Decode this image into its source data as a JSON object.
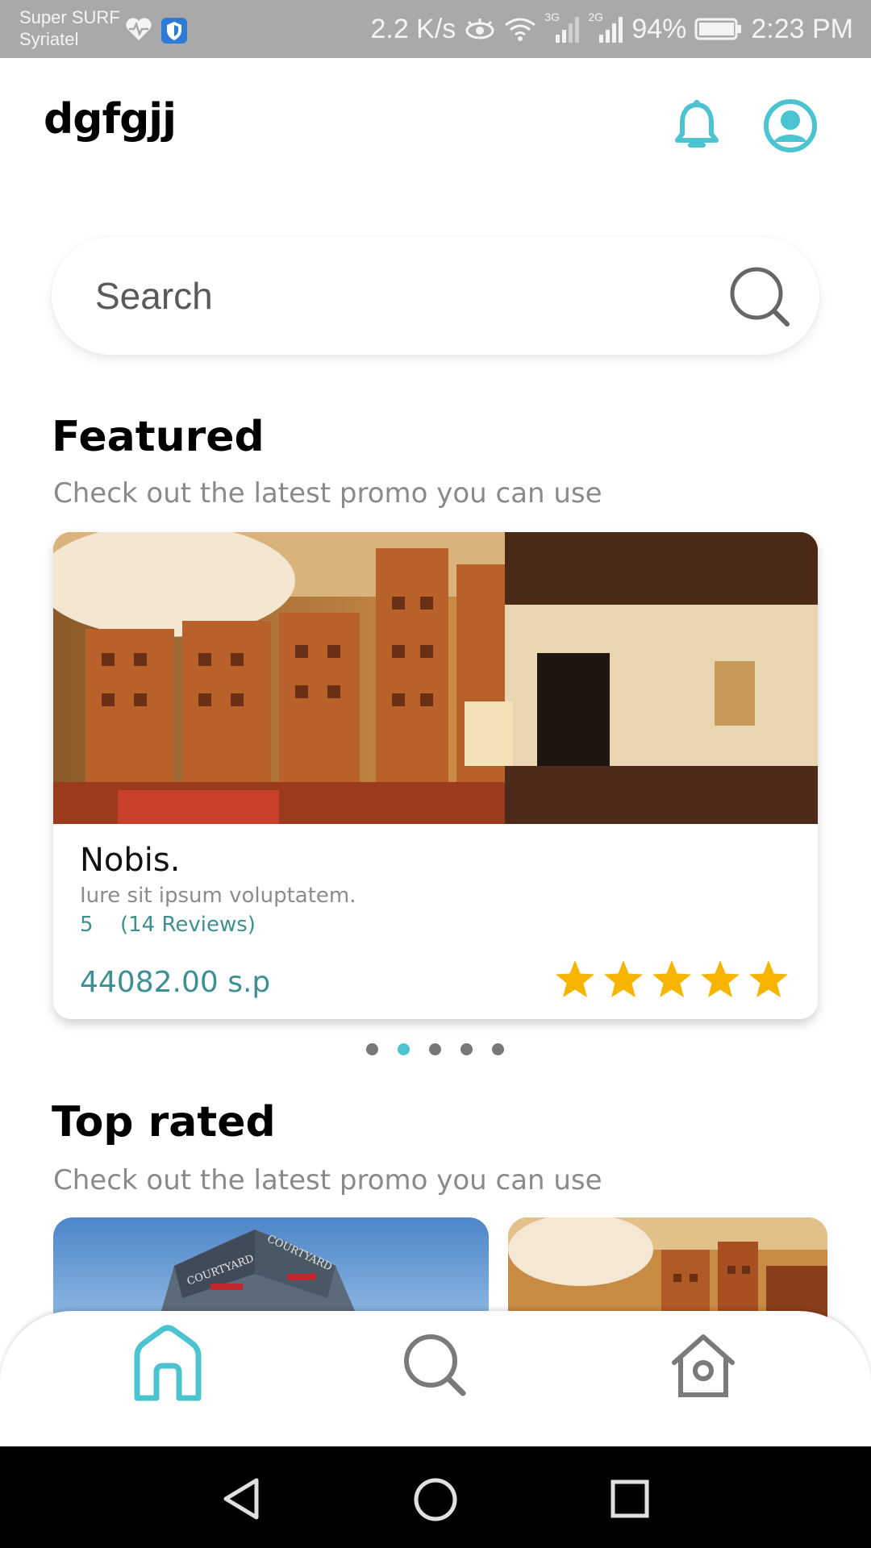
{
  "status_bar": {
    "carrier_line1": "Super SURF",
    "carrier_line2": "Syriatel",
    "net_speed": "2.2 K/s",
    "net_3g": "3G",
    "net_2g": "2G",
    "battery": "94%",
    "time": "2:23 PM",
    "icons": [
      "heartbeat-icon",
      "shield-icon",
      "eye-icon",
      "wifi-icon",
      "signal-icon",
      "battery-icon"
    ]
  },
  "header": {
    "title": "dgfgjj",
    "icons": [
      "bell-icon",
      "user-icon"
    ]
  },
  "search": {
    "placeholder": "Search"
  },
  "featured": {
    "title": "Featured",
    "subtitle": "Check out the latest promo you can use",
    "card": {
      "name": "Nobis.",
      "description": "Iure sit ipsum voluptatem.",
      "rating": "5",
      "reviews": "(14 Reviews)",
      "price": "44082.00 s.p",
      "stars": 5
    },
    "carousel": {
      "count": 5,
      "active_index": 1
    }
  },
  "top_rated": {
    "title": "Top rated",
    "subtitle": "Check out the latest promo you can use",
    "sign_text": "COURTYARD"
  },
  "bottom_nav": {
    "items": [
      "home-icon",
      "search-icon",
      "house-icon"
    ],
    "active": "home-icon"
  },
  "colors": {
    "accent": "#4bc3d0",
    "price_teal": "#3e8f94",
    "star_gold": "#f7b500",
    "status_bar": "#a9a9a9"
  }
}
